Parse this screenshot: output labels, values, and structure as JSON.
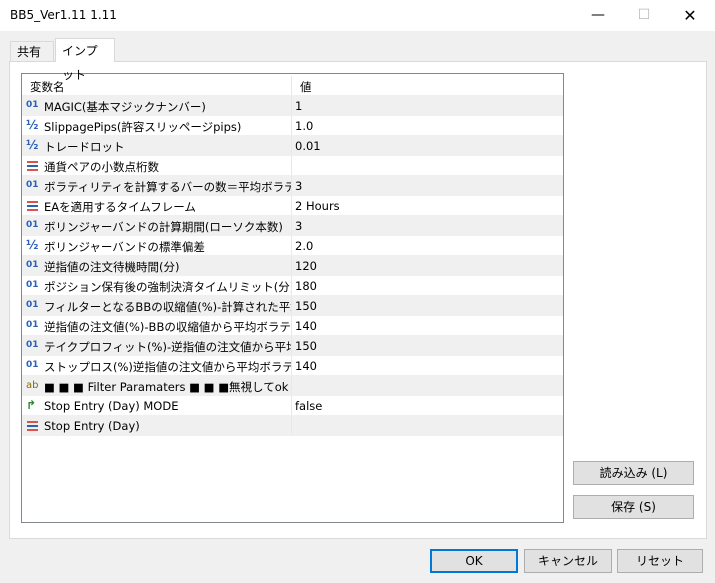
{
  "window": {
    "title": "BB5_Ver1.11 1.11"
  },
  "tabs": [
    {
      "label": "共有"
    },
    {
      "label": "インプット"
    }
  ],
  "grid": {
    "headers": {
      "name": "変数名",
      "value": "値"
    },
    "rows": [
      {
        "icon": "int-icon",
        "name": "MAGIC(基本マジックナンバー)",
        "value": "1"
      },
      {
        "icon": "double-icon",
        "name": "SlippagePips(許容スリッページpips)",
        "value": "1.0"
      },
      {
        "icon": "double-icon",
        "name": "トレードロット",
        "value": "0.01"
      },
      {
        "icon": "enum-icon",
        "name": "通貨ペアの小数点桁数",
        "value": ""
      },
      {
        "icon": "int-icon",
        "name": "ボラティリティを計算するバーの数＝平均ボラティリティ",
        "value": "3"
      },
      {
        "icon": "enum-icon",
        "name": "EAを適用するタイムフレーム",
        "value": "2 Hours"
      },
      {
        "icon": "int-icon",
        "name": "ボリンジャーバンドの計算期間(ローソク本数)",
        "value": "3"
      },
      {
        "icon": "double-icon",
        "name": "ボリンジャーバンドの標準偏差",
        "value": "2.0"
      },
      {
        "icon": "int-icon",
        "name": "逆指値の注文待機時間(分)",
        "value": "120"
      },
      {
        "icon": "int-icon",
        "name": "ポジション保有後の強制決済タイムリミット(分)",
        "value": "180"
      },
      {
        "icon": "int-icon",
        "name": "フィルターとなるBBの収縮値(%)-計算された平均...",
        "value": "150"
      },
      {
        "icon": "int-icon",
        "name": "逆指値の注文値(%)-BBの収縮値から平均ボラテ...",
        "value": "140"
      },
      {
        "icon": "int-icon",
        "name": "テイクプロフィット(%)-逆指値の注文値から平均ボ...",
        "value": "150"
      },
      {
        "icon": "int-icon",
        "name": "ストップロス(%)逆指値の注文値から平均ボラティ...",
        "value": "140"
      },
      {
        "icon": "string-icon",
        "name": "■ ■ ■ Filter Paramaters ■ ■ ■無視してok",
        "value": ""
      },
      {
        "icon": "bool-icon",
        "name": "Stop Entry (Day) MODE",
        "value": "false"
      },
      {
        "icon": "enum-icon",
        "name": "Stop Entry (Day)",
        "value": ""
      }
    ]
  },
  "buttons": {
    "load": "読み込み (L)",
    "save": "保存 (S)",
    "ok": "OK",
    "cancel": "キャンセル",
    "reset": "リセット"
  },
  "icons": {
    "minimize": "—",
    "maximize": "☐",
    "close": "✕",
    "int_glyph": "01",
    "double_glyph": "½",
    "string_glyph": "ab",
    "bool_glyph": "↱"
  },
  "colors": {
    "icon_blue": "#2b5fb8",
    "enum_top": "#d9534f",
    "enum_mid": "#2b5fb8",
    "bool_green": "#2b8a2b",
    "ok_border": "#0078d7"
  }
}
